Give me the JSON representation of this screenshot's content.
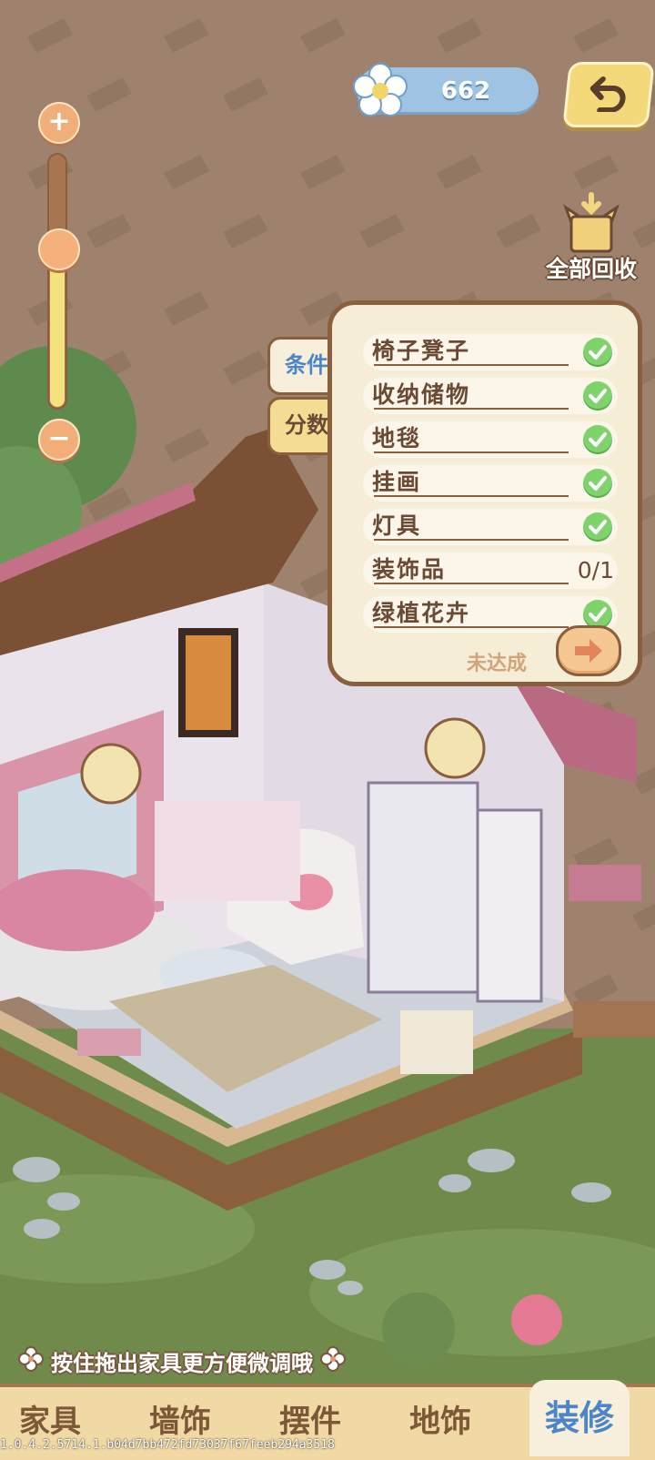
{
  "hud": {
    "currency_icon": "flower-icon",
    "currency_value": "662",
    "back_icon": "undo-arrow-icon",
    "recycle_icon": "box-recycle-icon",
    "recycle_label": "全部回收"
  },
  "zoom": {
    "plus_label": "+",
    "minus_label": "−",
    "level_fraction": 0.63
  },
  "panel": {
    "tabs": [
      {
        "label": "条件",
        "active": true
      },
      {
        "label": "分数",
        "active": false
      }
    ],
    "conditions": [
      {
        "name": "椅子凳子",
        "done": true,
        "progress": ""
      },
      {
        "name": "收纳储物",
        "done": true,
        "progress": ""
      },
      {
        "name": "地毯",
        "done": true,
        "progress": ""
      },
      {
        "name": "挂画",
        "done": true,
        "progress": ""
      },
      {
        "name": "灯具",
        "done": true,
        "progress": ""
      },
      {
        "name": "装饰品",
        "done": false,
        "progress": "0/1"
      },
      {
        "name": "绿植花卉",
        "done": true,
        "progress": ""
      }
    ],
    "status_text": "未达成",
    "next_icon": "arrow-right-icon"
  },
  "hint": {
    "text": "按住拖出家具更方便微调哦"
  },
  "nav": {
    "items": [
      {
        "label": "家具",
        "active": false
      },
      {
        "label": "墙饰",
        "active": false
      },
      {
        "label": "摆件",
        "active": false
      },
      {
        "label": "地饰",
        "active": false
      },
      {
        "label": "装修",
        "active": true
      }
    ]
  },
  "version": "1.0.4.2.5714.1.b04d7bb472fd73037f67feeb294a3518",
  "colors": {
    "accent_blue": "#4c86c7",
    "check_green": "#7fd36e",
    "panel_bg": "#f6edd7",
    "border_brown": "#8a5f3e"
  }
}
